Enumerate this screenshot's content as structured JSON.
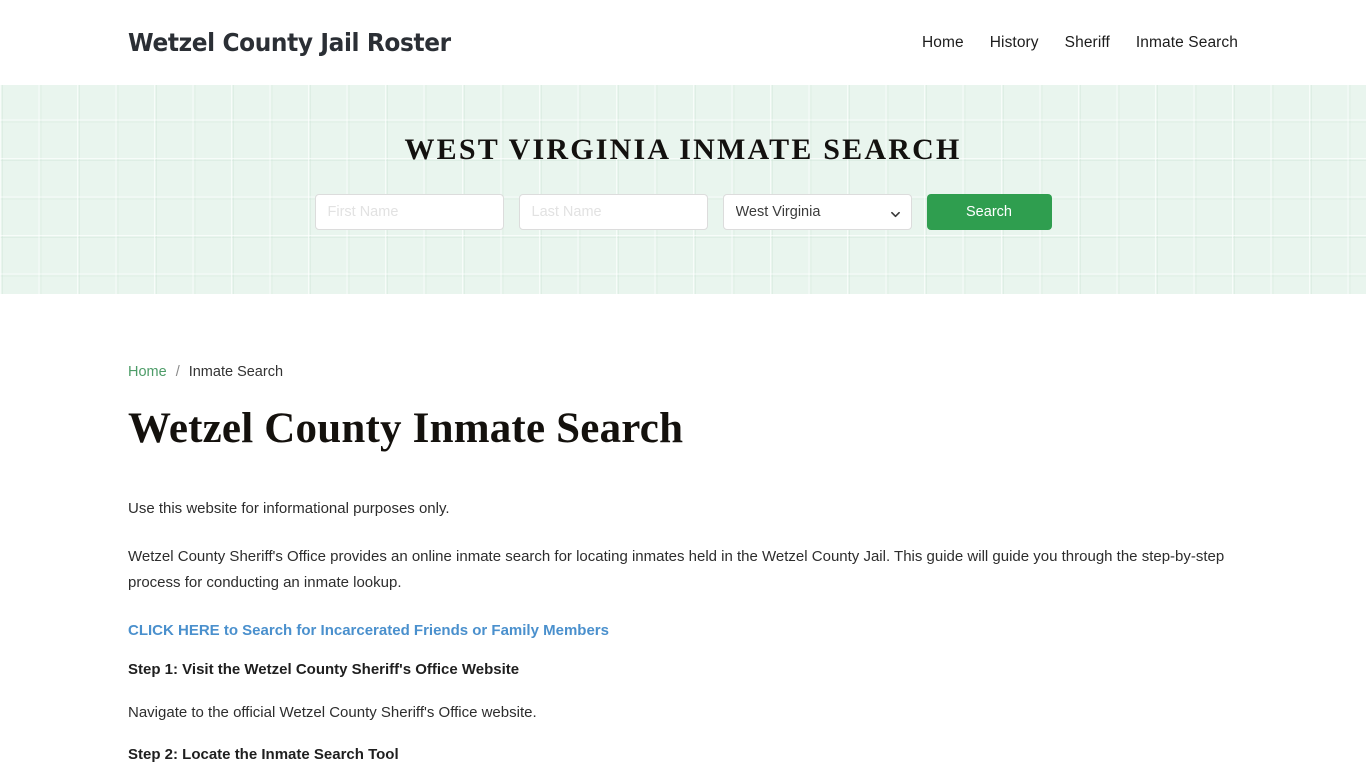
{
  "header": {
    "brand": "Wetzel County Jail Roster",
    "nav": [
      {
        "label": "Home"
      },
      {
        "label": "History"
      },
      {
        "label": "Sheriff"
      },
      {
        "label": "Inmate Search"
      }
    ]
  },
  "hero": {
    "title": "West Virginia Inmate Search",
    "search": {
      "first_name_value": "",
      "first_name_placeholder": "First Name",
      "last_name_value": "",
      "last_name_placeholder": "Last Name",
      "state_selected": "West Virginia",
      "state_options": [
        "West Virginia"
      ],
      "caret_icon": "chevron-down-icon",
      "submit_label": "Search"
    },
    "background_color": "#e9f5ee",
    "accent_color": "#2f9e4f"
  },
  "breadcrumb": {
    "home_label": "Home",
    "separator": "/",
    "current_label": "Inmate Search"
  },
  "main": {
    "title": "Wetzel County Inmate Search",
    "disclaimer": "Use this website for informational purposes only.",
    "intro": "Wetzel County Sheriff's Office provides an online inmate search for locating inmates held in the Wetzel County Jail. This guide will guide you through the step-by-step process for conducting an inmate lookup.",
    "cta_label": "CLICK HERE to Search for Incarcerated Friends or Family Members",
    "cta_color": "#4a90cd",
    "steps": [
      {
        "heading": "Step 1: Visit the Wetzel County Sheriff's Office Website",
        "body": "Navigate to the official Wetzel County Sheriff's Office website."
      },
      {
        "heading": "Step 2: Locate the Inmate Search Tool"
      }
    ]
  }
}
